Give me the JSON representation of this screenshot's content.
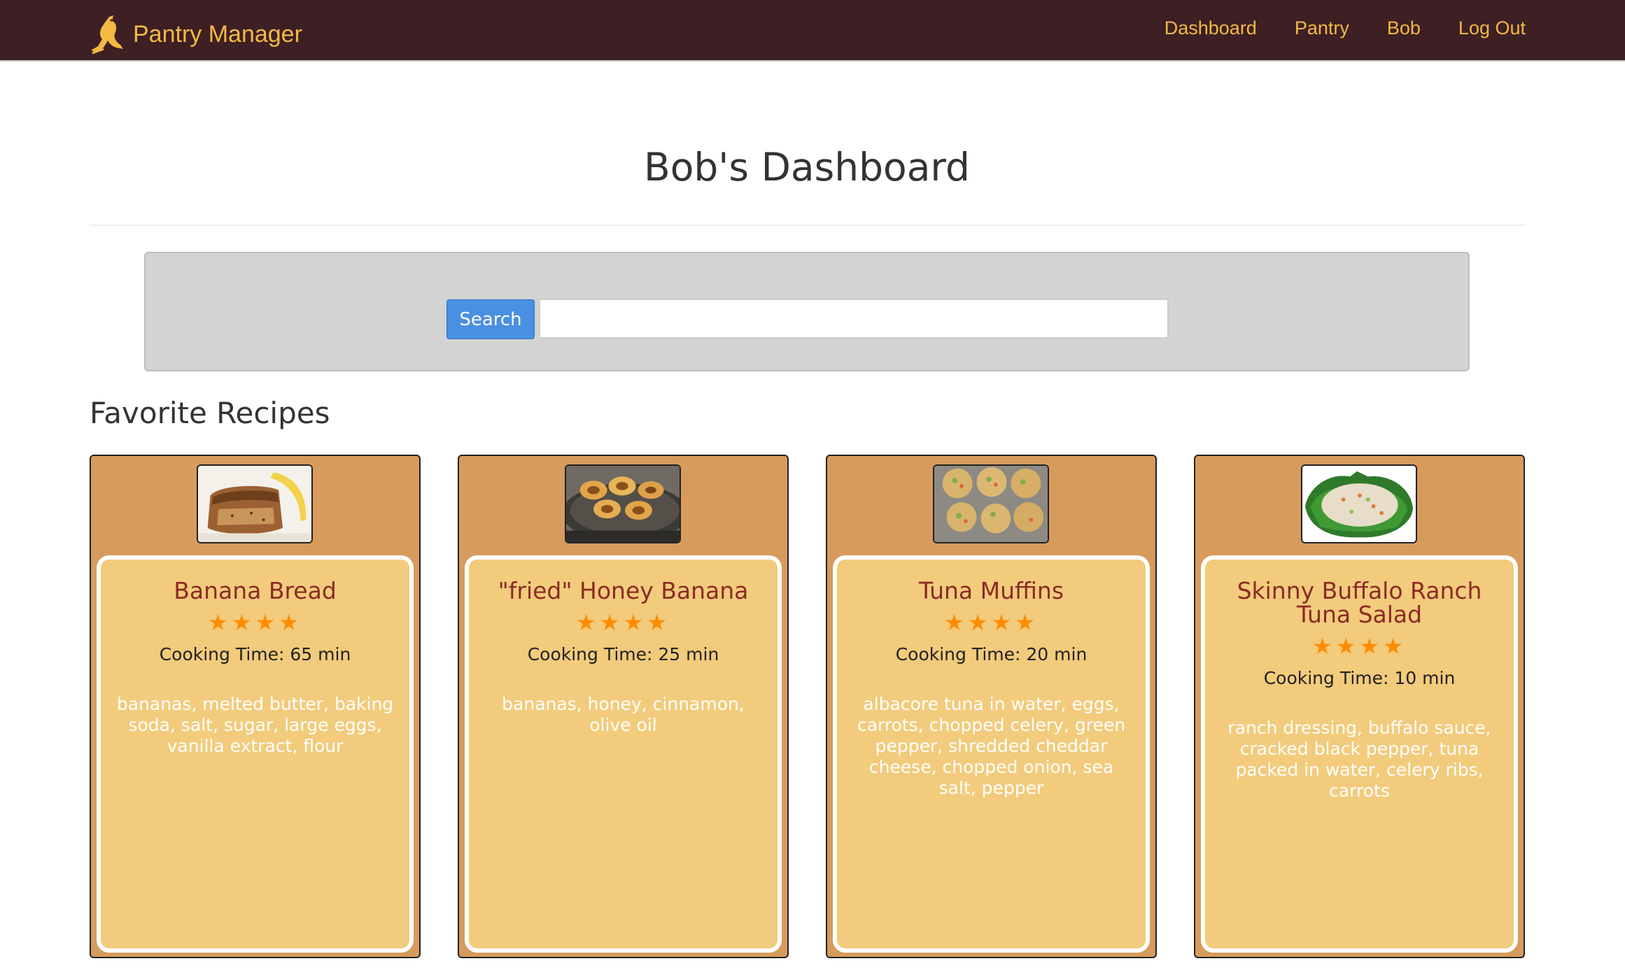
{
  "navbar": {
    "brand": "Pantry Manager",
    "links": [
      "Dashboard",
      "Pantry",
      "Bob",
      "Log Out"
    ],
    "logo_icon": "kangaroo-logo-icon",
    "bg_color": "#3d1f24",
    "accent_color": "#f4b942"
  },
  "header": {
    "title": "Bob's Dashboard"
  },
  "search": {
    "button_label": "Search",
    "value": "",
    "placeholder": ""
  },
  "favorites": {
    "heading": "Favorite Recipes",
    "recipes": [
      {
        "name": "Banana Bread",
        "rating": 4,
        "stars": "★★★★",
        "cooking_time": "Cooking Time: 65 min",
        "ingredients": "bananas, melted butter, baking soda, salt, sugar, large eggs, vanilla extract, flour",
        "image_icon": "banana-bread-photo"
      },
      {
        "name": "\"fried\" Honey Banana",
        "rating": 4,
        "stars": "★★★★",
        "cooking_time": "Cooking Time: 25 min",
        "ingredients": "bananas, honey, cinnamon, olive oil",
        "image_icon": "fried-honey-banana-photo"
      },
      {
        "name": "Tuna Muffins",
        "rating": 4,
        "stars": "★★★★",
        "cooking_time": "Cooking Time: 20 min",
        "ingredients": "albacore tuna in water, eggs, carrots, chopped celery, green pepper, shredded cheddar cheese, chopped onion, sea salt, pepper",
        "image_icon": "tuna-muffins-photo"
      },
      {
        "name": "Skinny Buffalo Ranch Tuna Salad",
        "rating": 4,
        "stars": "★★★★",
        "cooking_time": "Cooking Time: 10 min",
        "ingredients": "ranch dressing, buffalo sauce, cracked black pepper, tuna packed in water, celery ribs, carrots",
        "image_icon": "tuna-salad-photo"
      }
    ]
  }
}
